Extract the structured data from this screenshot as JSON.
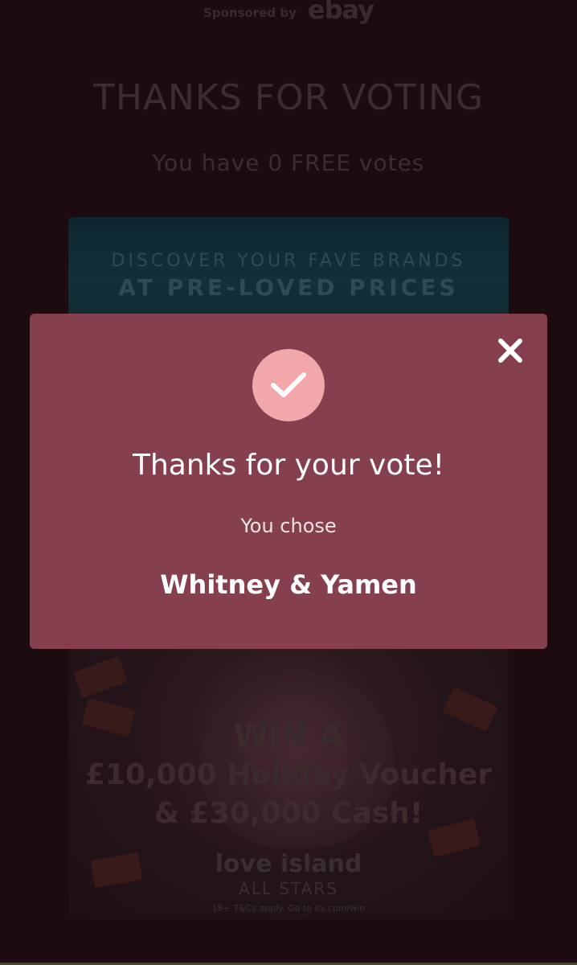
{
  "sponsor": {
    "label": "Sponsored by",
    "brand": "ebay"
  },
  "page": {
    "title": "THANKS FOR VOTING",
    "free_votes": "You have 0 FREE votes"
  },
  "ad": {
    "line1": "DISCOVER YOUR FAVE BRANDS",
    "line2": "AT PRE-LOVED PRICES",
    "win": "WIN A",
    "prize1": "£10,000 Holiday Voucher",
    "prize2": "& £30,000 Cash!",
    "logo_line1": "love island",
    "logo_line2": "ALL STARS",
    "tcs": "18+ T&Cs apply. Go to itv.com/win"
  },
  "modal": {
    "title": "Thanks for your vote!",
    "subtitle": "You chose",
    "choice": "Whitney & Yamen",
    "icons": {
      "check": "check-icon",
      "close": "close-icon"
    },
    "colors": {
      "background": "#853f4f",
      "check_circle": "#f2a7aa"
    }
  }
}
